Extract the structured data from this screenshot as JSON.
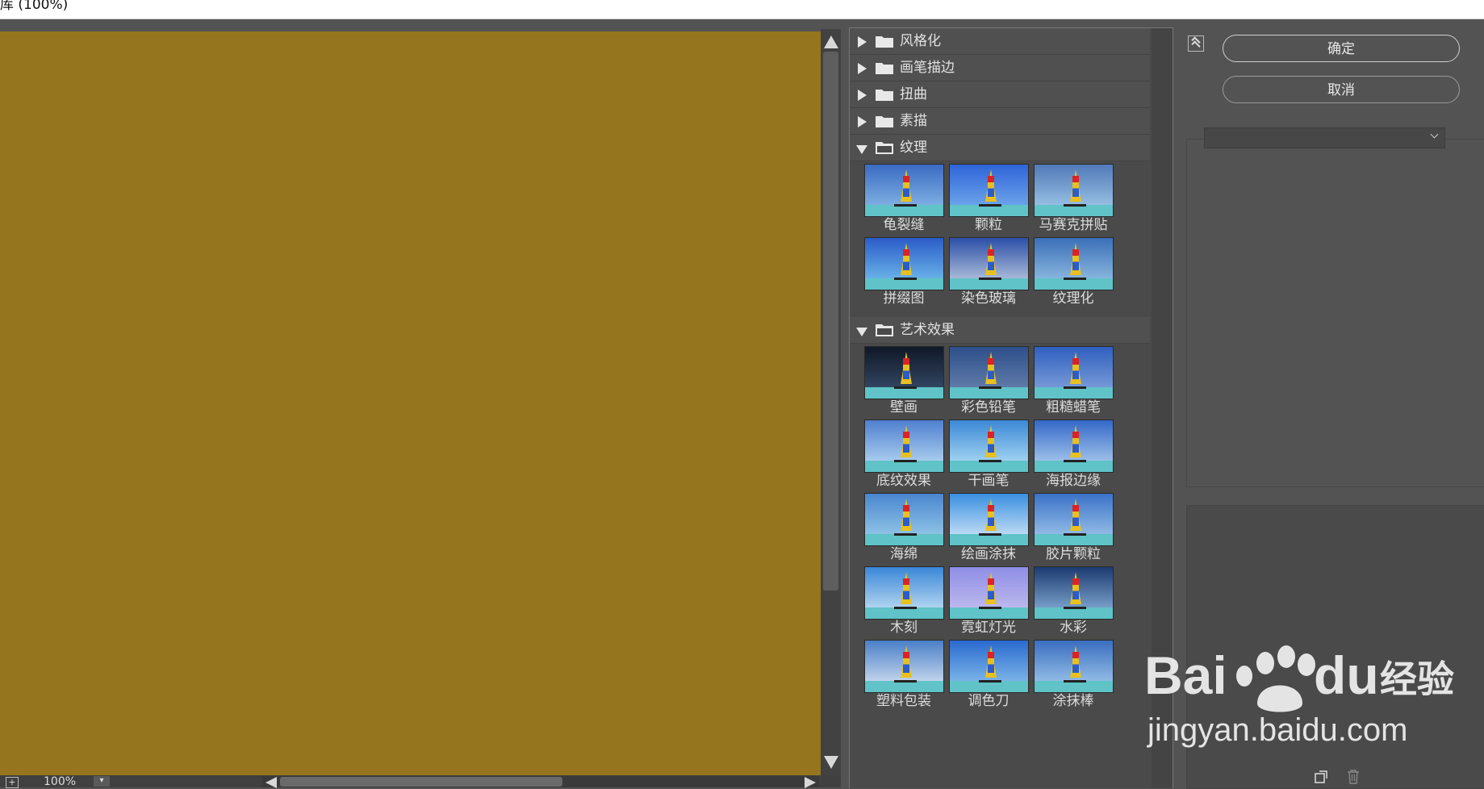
{
  "window": {
    "title": "库 (100%)"
  },
  "preview": {
    "canvas_color": "#95751d",
    "zoom_label": "100%",
    "zoom_in_symbol": "+",
    "zoom_dropdown_symbol": "▾"
  },
  "gallery": {
    "categories": [
      {
        "label": "风格化",
        "expanded": false
      },
      {
        "label": "画笔描边",
        "expanded": false
      },
      {
        "label": "扭曲",
        "expanded": false
      },
      {
        "label": "素描",
        "expanded": false
      },
      {
        "label": "纹理",
        "expanded": true,
        "filters": [
          "龟裂缝",
          "颗粒",
          "马赛克拼贴",
          "拼缀图",
          "染色玻璃",
          "纹理化"
        ]
      },
      {
        "label": "艺术效果",
        "expanded": true,
        "filters": [
          "壁画",
          "彩色铅笔",
          "粗糙蜡笔",
          "底纹效果",
          "干画笔",
          "海报边缘",
          "海绵",
          "绘画涂抹",
          "胶片颗粒",
          "木刻",
          "霓虹灯光",
          "水彩",
          "塑料包装",
          "调色刀",
          "涂抹棒"
        ]
      }
    ]
  },
  "settings": {
    "ok_label": "确定",
    "cancel_label": "取消",
    "filter_select_value": ""
  },
  "watermark": {
    "brand": "Bai",
    "brand2": "du",
    "cn": "经验",
    "url": "jingyan.baidu.com"
  }
}
